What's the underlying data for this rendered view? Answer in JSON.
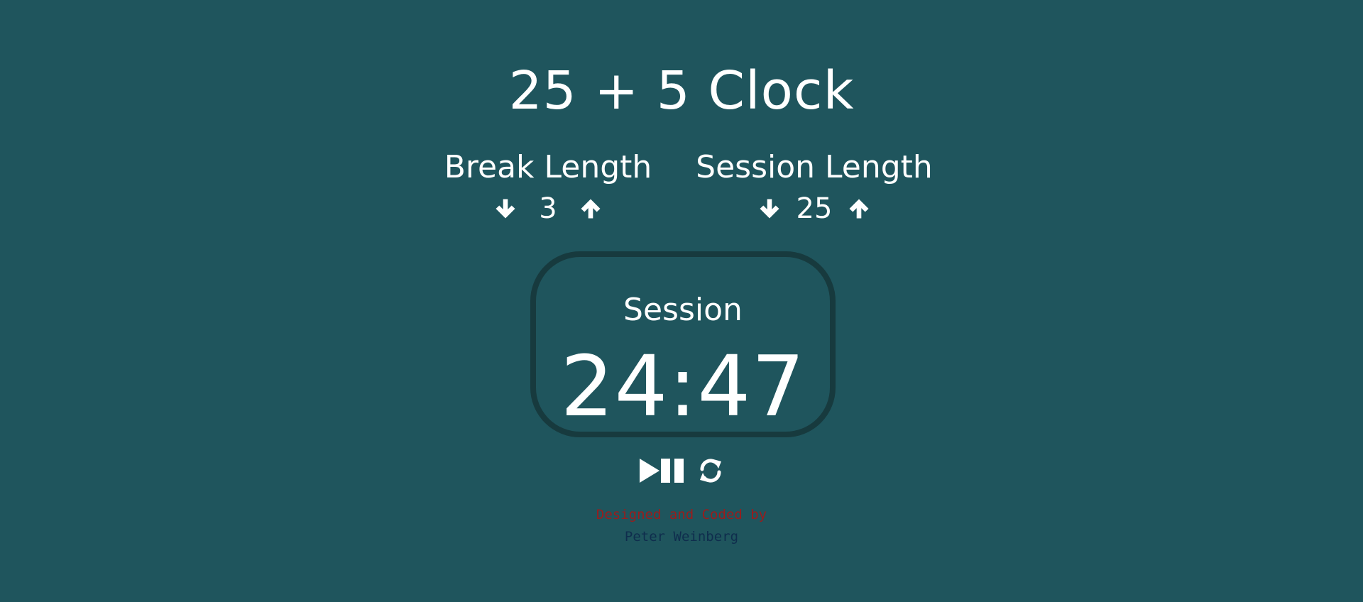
{
  "app": {
    "title": "25 + 5 Clock"
  },
  "break_control": {
    "label": "Break Length",
    "value": "3",
    "decrement_icon": "arrow-down-icon",
    "increment_icon": "arrow-up-icon"
  },
  "session_control": {
    "label": "Session Length",
    "value": "25",
    "decrement_icon": "arrow-down-icon",
    "increment_icon": "arrow-up-icon"
  },
  "timer": {
    "label": "Session",
    "time_left": "24:47"
  },
  "controls": {
    "start_stop_icon": "play-pause-icon",
    "reset_icon": "refresh-icon"
  },
  "credit": {
    "line1": "Designed and Coded by",
    "line2": "Peter Weinberg"
  },
  "colors": {
    "background": "#1f555d",
    "timer_border": "#173a3e",
    "text": "#ffffff",
    "credit_line1": "#9b1c1c",
    "credit_line2": "#0f2d4d"
  }
}
